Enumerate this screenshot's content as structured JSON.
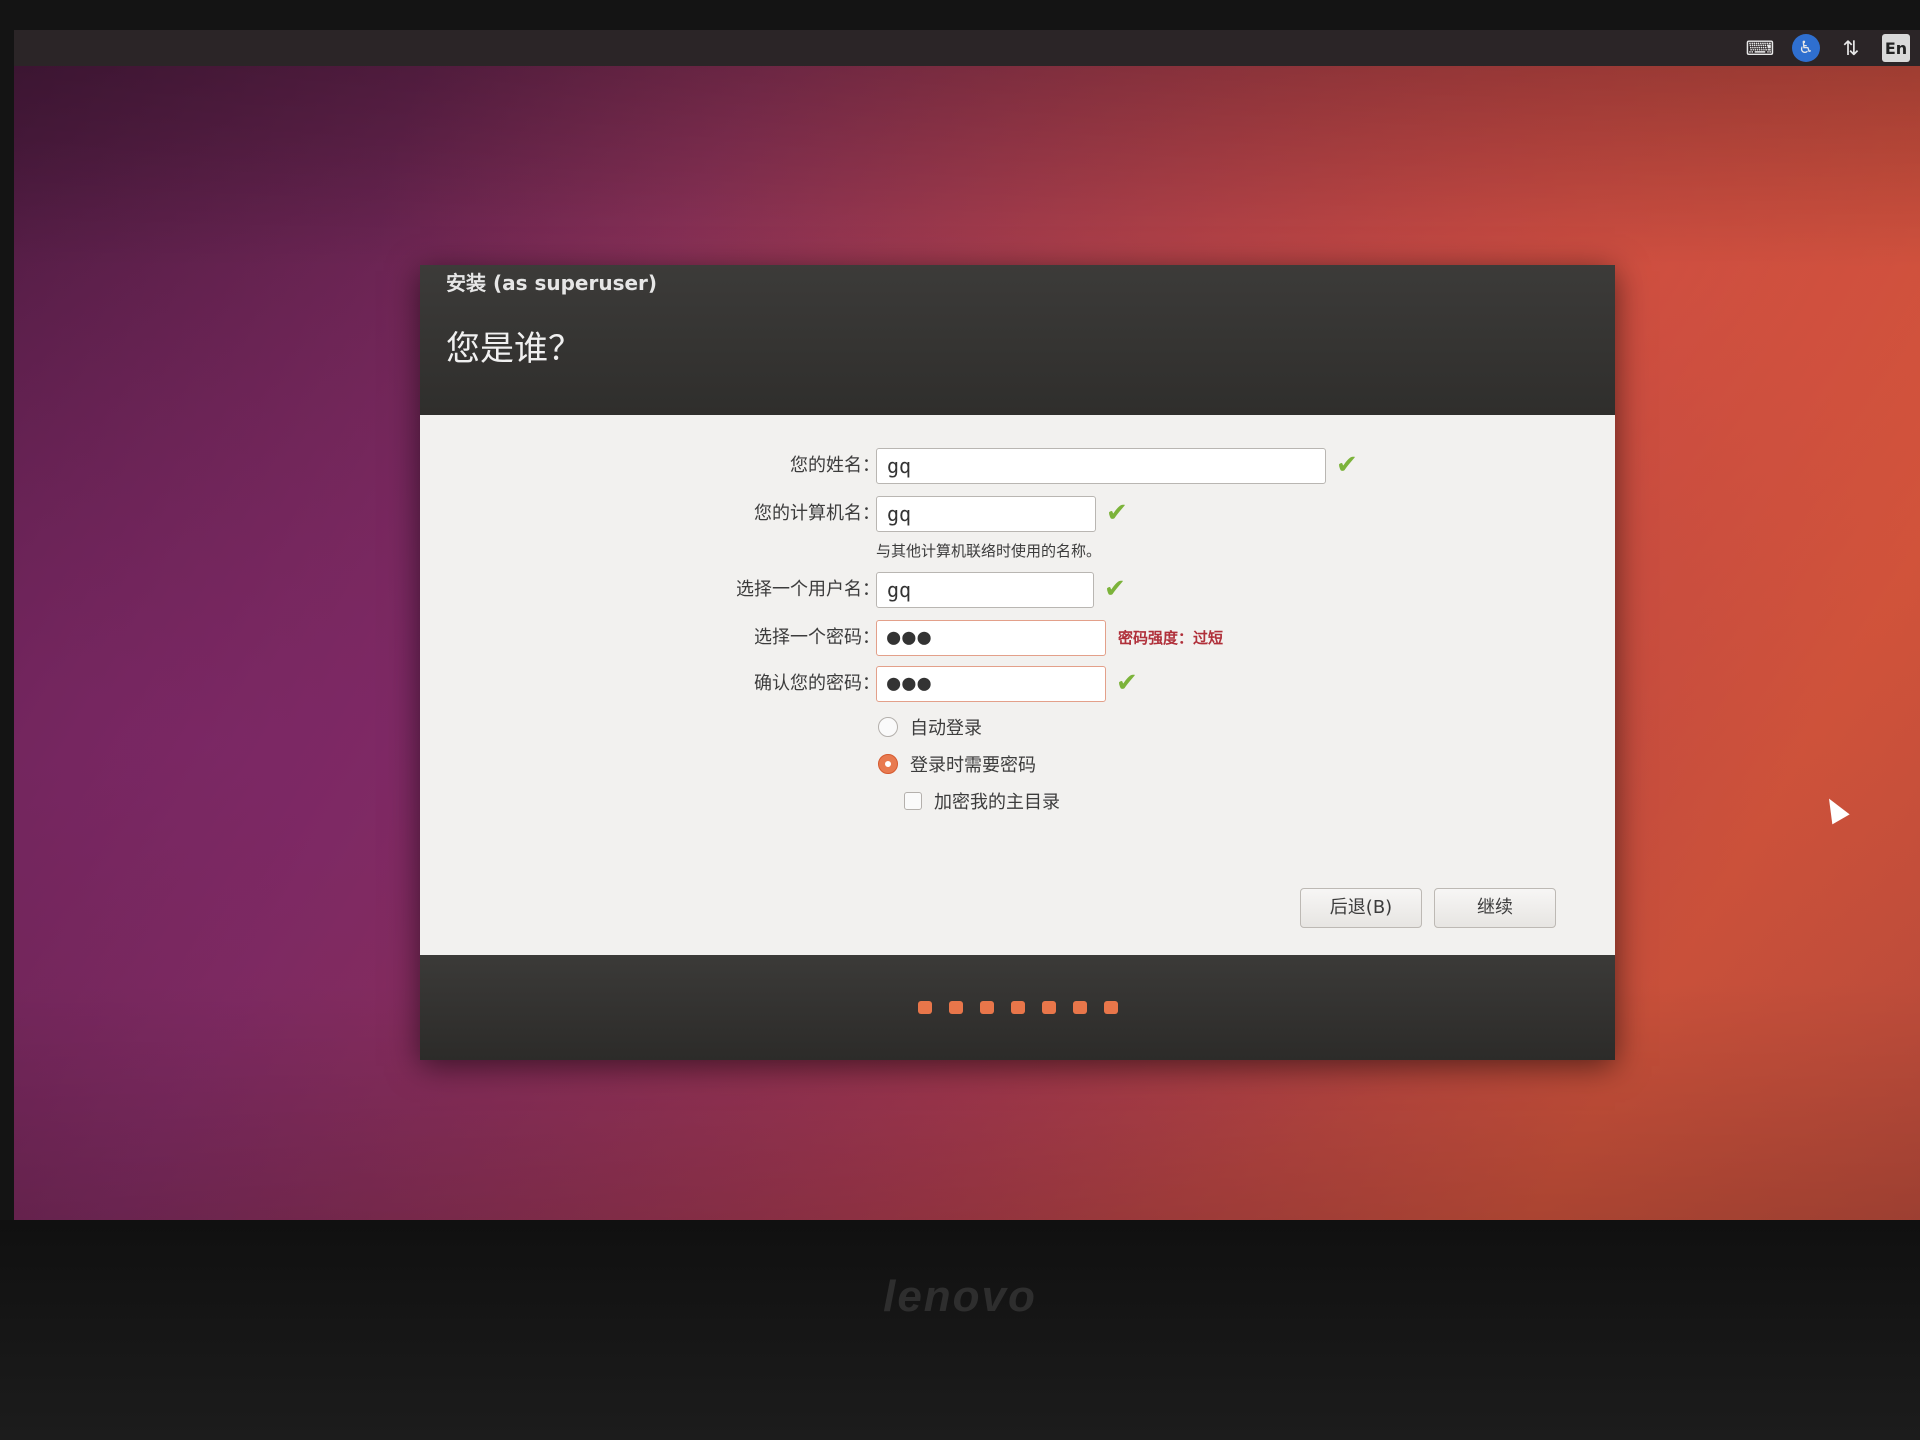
{
  "tray": {
    "keyboard_icon": "keyboard-icon",
    "accessibility_icon": "accessibility-icon",
    "network_icon": "network-updown-icon",
    "language_label": "En"
  },
  "window": {
    "title": "安装 (as superuser)",
    "heading": "您是谁？"
  },
  "form": {
    "name": {
      "label": "您的姓名：",
      "value": "gq"
    },
    "computer": {
      "label": "您的计算机名：",
      "value": "gq",
      "hint": "与其他计算机联络时使用的名称。"
    },
    "username": {
      "label": "选择一个用户名：",
      "value": "gq"
    },
    "password": {
      "label": "选择一个密码：",
      "value": "●●●",
      "strength": "密码强度：过短"
    },
    "confirm": {
      "label": "确认您的密码：",
      "value": "●●●"
    },
    "check_symbol": "✔"
  },
  "options": {
    "auto_login": {
      "label": "自动登录",
      "selected": false
    },
    "require_password": {
      "label": "登录时需要密码",
      "selected": true
    },
    "encrypt_home": {
      "label": "加密我的主目录",
      "checked": false
    }
  },
  "buttons": {
    "back": "后退(B)",
    "continue": "继续"
  },
  "progress": {
    "total_steps": 7
  },
  "monitor_brand": "lenovo",
  "colors": {
    "accent": "#e8764a",
    "ok_check": "#7cb33a",
    "warning_text": "#b0303a"
  }
}
